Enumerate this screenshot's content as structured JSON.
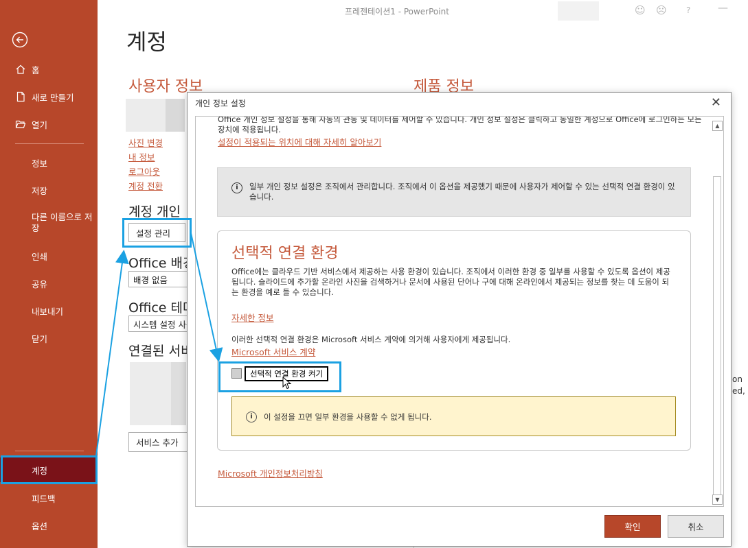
{
  "window": {
    "title": "프레젠테이션1  -  PowerPoint"
  },
  "nav": {
    "home": "홈",
    "new": "새로 만들기",
    "open": "열기",
    "info": "정보",
    "save": "저장",
    "save_as": "다른 이름으로 저장",
    "print": "인쇄",
    "share": "공유",
    "export": "내보내기",
    "close": "닫기",
    "account": "계정",
    "feedback": "피드백",
    "options": "옵션"
  },
  "page": {
    "title": "계정",
    "user_info_heading": "사용자 정보",
    "product_info_heading": "제품 정보",
    "links": {
      "change_photo": "사진 변경",
      "about_me": "내 정보",
      "sign_out": "로그아웃",
      "switch_account": "계정 전환"
    },
    "account_privacy_heading": "계정 개인",
    "manage_settings_button": "설정 관리",
    "office_background_heading": "Office 배경",
    "office_background_value": "배경 없음",
    "office_theme_heading": "Office 테마",
    "office_theme_value": "시스템 설정 사용",
    "connected_services_heading": "연결된 서비스",
    "add_service_button": "서비스 추가",
    "edge_text_1": "on",
    "edge_text_2": "ed,"
  },
  "dialog": {
    "title": "개인 정보 설정",
    "top_text": "Office 개인 정보 설정을 통해 자동의 관동 및 데이터를 제어할 수 있습니다. 개인 정보 설정은 클릭하고 동일한 계정으로 Office에 로그인하는 모든 장치에 적용됩니다.",
    "top_link": "설정이 적용되는 위치에 대해 자세히 알아보기",
    "info_text": "일부 개인 정보 설정은 조직에서 관리합니다. 조직에서 이 옵션을 제공했기 때문에 사용자가 제어할 수 있는 선택적 연결 환경이 있습니다.",
    "section_heading": "선택적 연결 환경",
    "section_desc": "Office에는 클라우드 기반 서비스에서 제공하는 사용 환경이 있습니다. 조직에서 이러한 환경 중 일부를 사용할 수 있도록 옵션이 제공됩니다. 슬라이드에 추가할 온라인 사진을 검색하거나 문서에 사용된 단어나 구에 대해 온라인에서 제공되는 정보를 찾는 데 도움이 되는 환경을 예로 들 수 있습니다.",
    "learn_more_link": "자세한 정보",
    "agreement_text": "이러한 선택적 연결 환경은 Microsoft 서비스 계약에 의거해 사용자에게 제공됩니다.",
    "agreement_link": "Microsoft 서비스 계약",
    "checkbox_label": "선택적 연결 환경 켜기",
    "checkbox_checked": false,
    "warning_text": "이 설정을 끄면 일부 환경을 사용할 수 없게 됩니다.",
    "privacy_link": "Microsoft 개인정보처리방침",
    "ok_button": "확인",
    "cancel_button": "취소"
  },
  "colors": {
    "nav_background": "#b7472a",
    "nav_active": "#7a1218",
    "accent_text": "#c55a3c",
    "highlight": "#1ba1e2",
    "warning_background": "#fff4ce"
  },
  "icons": [
    "back-arrow-icon",
    "home-icon",
    "new-file-icon",
    "open-folder-icon",
    "info-icon",
    "close-icon",
    "smiley-icon",
    "frown-icon",
    "help-icon",
    "minimize-icon",
    "cursor-icon"
  ]
}
